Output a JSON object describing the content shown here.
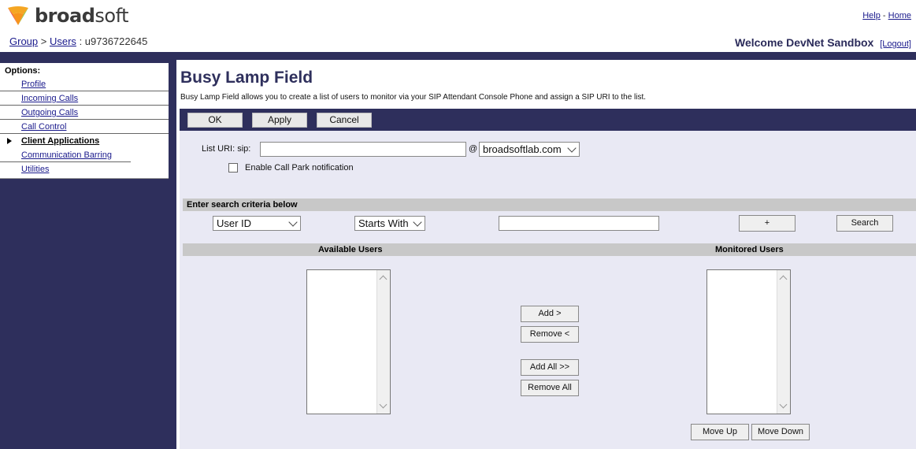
{
  "header": {
    "logo_text_bold": "broad",
    "logo_text_light": "soft",
    "help_link": "Help",
    "separator": "-",
    "home_link": "Home",
    "breadcrumb": {
      "group": "Group",
      "gt": ">",
      "users": "Users",
      "user_id": ": u9736722645"
    },
    "welcome": "Welcome DevNet Sandbox",
    "logout": "[Logout]"
  },
  "sidebar": {
    "title": "Options:",
    "items": [
      {
        "label": "Profile"
      },
      {
        "label": "Incoming Calls"
      },
      {
        "label": "Outgoing Calls"
      },
      {
        "label": "Call Control"
      },
      {
        "label": "Client Applications"
      },
      {
        "label": "Communication Barring"
      },
      {
        "label": "Utilities"
      }
    ]
  },
  "page": {
    "title": "Busy Lamp Field",
    "description": "Busy Lamp Field allows you to create a list of users to monitor via your SIP Attendant Console Phone and assign a SIP URI to the list."
  },
  "toolbar": {
    "ok": "OK",
    "apply": "Apply",
    "cancel": "Cancel"
  },
  "form": {
    "list_uri_label": "List URI: sip:",
    "list_uri_value": "",
    "at": "@",
    "domain": "broadsoftlab.com",
    "call_park_label": "Enable Call Park notification",
    "call_park_checked": false
  },
  "search": {
    "header": "Enter search criteria below",
    "field": "User ID",
    "mode": "Starts With",
    "value": "",
    "plus": "+",
    "search_button": "Search"
  },
  "lists": {
    "available_header": "Available Users",
    "monitored_header": "Monitored Users",
    "add": "Add >",
    "remove": "Remove <",
    "add_all": "Add All >>",
    "remove_all": "Remove All",
    "move_up": "Move Up",
    "move_down": "Move Down"
  },
  "colors": {
    "navy": "#2e2f5c",
    "panel": "#e9e9f4",
    "logo_orange": "#f5a623",
    "logo_red": "#e8453c",
    "logo_green": "#8cc63f"
  }
}
